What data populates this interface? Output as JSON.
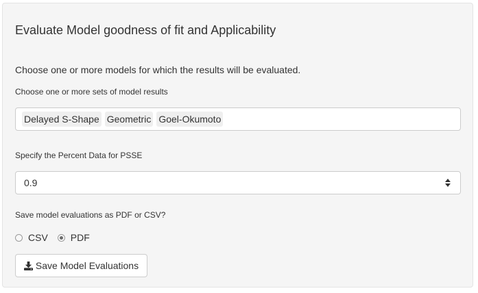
{
  "panel": {
    "title": "Evaluate Model goodness of fit and Applicability",
    "intro": "Choose one or more models for which the results will be evaluated."
  },
  "models": {
    "label": "Choose one or more sets of model results",
    "selected": [
      "Delayed S-Shape",
      "Geometric",
      "Goel-Okumoto"
    ]
  },
  "psse": {
    "label": "Specify the Percent Data for PSSE",
    "value": "0.9"
  },
  "save_format": {
    "label": "Save model evaluations as PDF or CSV?",
    "options": [
      "CSV",
      "PDF"
    ],
    "selected": "PDF"
  },
  "save_button": {
    "label": "Save Model Evaluations",
    "icon": "download-icon"
  }
}
